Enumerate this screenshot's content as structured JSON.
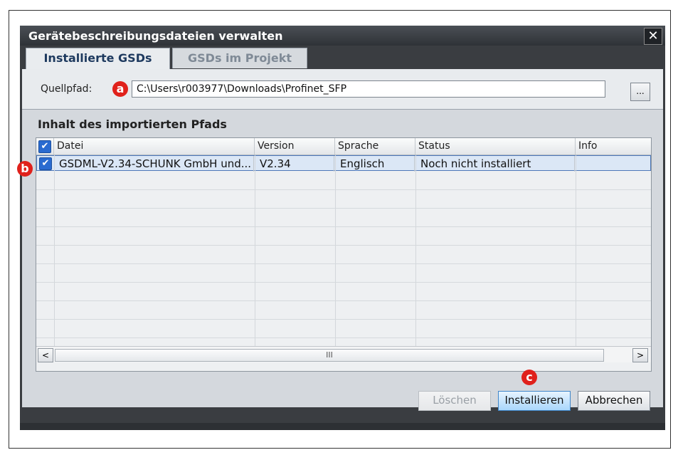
{
  "window": {
    "title": "Gerätebeschreibungsdateien verwalten",
    "close_glyph": "✕"
  },
  "tabs": [
    {
      "label": "Installierte GSDs"
    },
    {
      "label": "GSDs im Projekt"
    }
  ],
  "source": {
    "label": "Quellpfad:",
    "path": "C:\\Users\\r003977\\Downloads\\Profinet_SFP",
    "browse_label": "..."
  },
  "callouts": {
    "a": "a",
    "b": "b",
    "c": "c"
  },
  "section_title": "Inhalt des importierten Pfads",
  "table": {
    "headers": [
      "Datei",
      "Version",
      "Sprache",
      "Status",
      "Info"
    ],
    "rows": [
      {
        "checked": true,
        "datei": "GSDML-V2.34-SCHUNK GmbH und...",
        "version": "V2.34",
        "sprache": "Englisch",
        "status": "Noch nicht installiert",
        "info": ""
      }
    ],
    "scroll_thumb_glyph": "III",
    "scroll_left_glyph": "<",
    "scroll_right_glyph": ">"
  },
  "buttons": {
    "delete": "Löschen",
    "install": "Installieren",
    "cancel": "Abbrechen"
  },
  "colors": {
    "callout": "#e0211b",
    "selection": "#dbe7f6",
    "accent": "#2a6bd0"
  }
}
